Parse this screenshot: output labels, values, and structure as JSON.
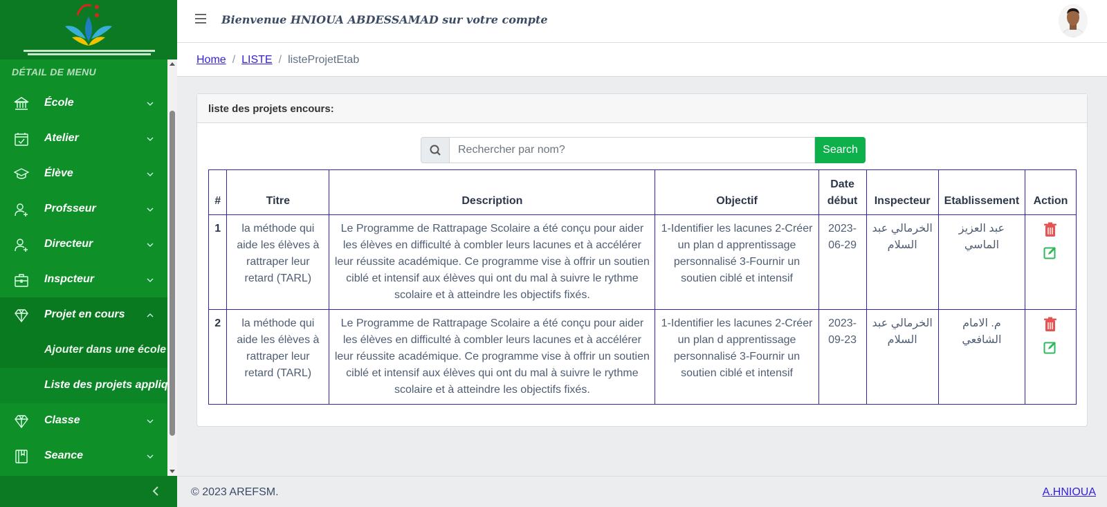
{
  "header": {
    "welcome": "Bienvenue HNIOUA ABDESSAMAD sur votre compte"
  },
  "sidebar": {
    "title": "DÉTAIL DE MENU",
    "items": [
      {
        "label": "École",
        "icon": "bank-icon"
      },
      {
        "label": "Atelier",
        "icon": "calendar-check-icon"
      },
      {
        "label": "Élève",
        "icon": "graduation-cap-icon"
      },
      {
        "label": "Profsseur",
        "icon": "user-plus-icon"
      },
      {
        "label": "Directeur",
        "icon": "user-plus-icon"
      },
      {
        "label": "Inspcteur",
        "icon": "briefcase-icon"
      },
      {
        "label": "Projet en cours",
        "icon": "diamond-icon"
      },
      {
        "label": "Classe",
        "icon": "diamond-icon"
      },
      {
        "label": "Seance",
        "icon": "book-icon"
      }
    ],
    "subitems": [
      {
        "label": "Ajouter dans une école"
      },
      {
        "label": "Liste des projets appliqués"
      }
    ]
  },
  "breadcrumb": {
    "home": "Home",
    "list": "LISTE",
    "current": "listeProjetEtab"
  },
  "card": {
    "title": "liste des projets encours:"
  },
  "search": {
    "placeholder": "Rechercher par nom?",
    "button": "Search"
  },
  "table": {
    "headers": [
      "#",
      "Titre",
      "Description",
      "Objectif",
      "Date début",
      "Inspecteur",
      "Etablissement",
      "Action"
    ],
    "rows": [
      {
        "num": "1",
        "titre": "la méthode qui aide les élèves à rattraper leur retard (TARL)",
        "description": "Le Programme de Rattrapage Scolaire a été conçu pour aider les élèves en difficulté à combler leurs lacunes et à accélérer leur réussite académique. Ce programme vise à offrir un soutien ciblé et intensif aux élèves qui ont du mal à suivre le rythme scolaire et à atteindre les objectifs fixés.",
        "objectif": "1-Identifier les lacunes 2-Créer un plan d apprentissage personnalisé 3-Fournir un soutien ciblé et intensif",
        "date": "2023-06-29",
        "inspecteur": "الخرمالي عبد السلام",
        "etablissement": "عبد العزيز الماسي"
      },
      {
        "num": "2",
        "titre": "la méthode qui aide les élèves à rattraper leur retard (TARL)",
        "description": "Le Programme de Rattrapage Scolaire a été conçu pour aider les élèves en difficulté à combler leurs lacunes et à accélérer leur réussite académique. Ce programme vise à offrir un soutien ciblé et intensif aux élèves qui ont du mal à suivre le rythme scolaire et à atteindre les objectifs fixés.",
        "objectif": "1-Identifier les lacunes 2-Créer un plan d apprentissage personnalisé 3-Fournir un soutien ciblé et intensif",
        "date": "2023-09-23",
        "inspecteur": "الخرمالي عبد السلام",
        "etablissement": "م. الامام الشافعي"
      }
    ]
  },
  "footer": {
    "copyright": "© 2023 AREFSM.",
    "author": "A.HNIOUA"
  },
  "colors": {
    "sidebar": "#0e8f28",
    "accent": "#0eb04b",
    "link": "#321fdb",
    "delete": "#e55353",
    "edit": "#2eb85c"
  }
}
